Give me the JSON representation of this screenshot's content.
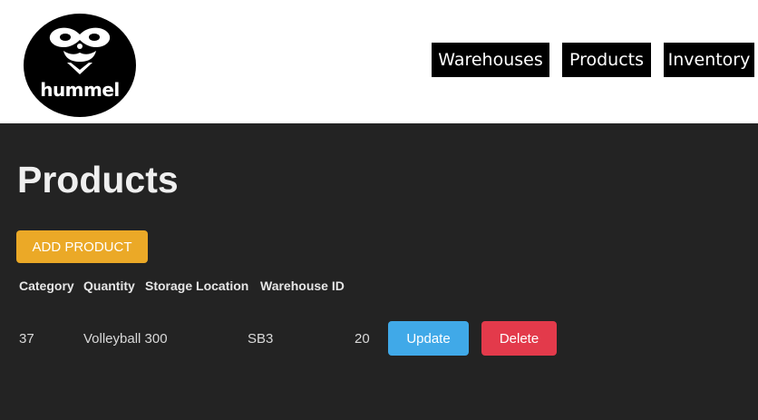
{
  "header": {
    "logo_text": "hummel",
    "nav": [
      {
        "label": "Warehouses"
      },
      {
        "label": "Products"
      },
      {
        "label": "Inventory"
      }
    ]
  },
  "main": {
    "title": "Products",
    "add_button_label": "ADD PRODUCT",
    "table": {
      "columns": [
        "Category",
        "Quantity",
        "Storage Location",
        "Warehouse ID"
      ],
      "rows": [
        {
          "cells": [
            "37",
            "Volleyball 300",
            "SB3",
            "20"
          ],
          "update_label": "Update",
          "delete_label": "Delete"
        }
      ]
    }
  },
  "colors": {
    "main_bg": "#232323",
    "add_button": "#eba927",
    "update_button": "#40a9e8",
    "delete_button": "#e33a4b"
  }
}
